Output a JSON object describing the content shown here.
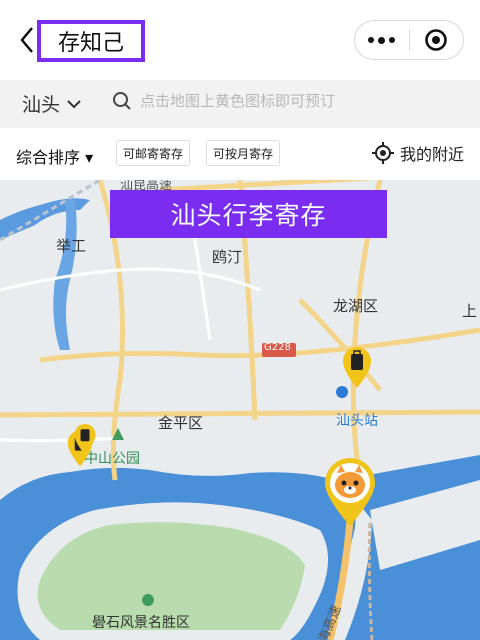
{
  "header": {
    "title": "存知己",
    "back_icon": "back-chevron-icon",
    "more_icon": "more-dots-icon",
    "target_icon": "capsule-target-icon"
  },
  "search": {
    "city": "汕头",
    "placeholder": "点击地图上黄色图标即可预订"
  },
  "filters": {
    "sort_label": "综合排序 ▾",
    "chip_mail": "可邮寄寄存",
    "chip_month": "可按月寄存",
    "nearby_label": "我的附近"
  },
  "banner": {
    "text": "汕头行李寄存"
  },
  "map": {
    "labels": {
      "juegong": "举工",
      "outing": "鸥汀",
      "longhu": "龙湖区",
      "shang": "上",
      "g228": "G228",
      "jinping": "金平区",
      "zhongshan_park": "中山公园",
      "shantou_station": "汕头站",
      "queshi": "礐石风景名胜区",
      "road_top": "汕昆高速",
      "road_bottom": "汕海高速"
    },
    "colors": {
      "accent": "#7a2cf0",
      "water": "#4a90d9",
      "land": "#e9ecef",
      "green": "#b9dcae",
      "road": "#f3d489",
      "pin": "#f0c419"
    }
  }
}
